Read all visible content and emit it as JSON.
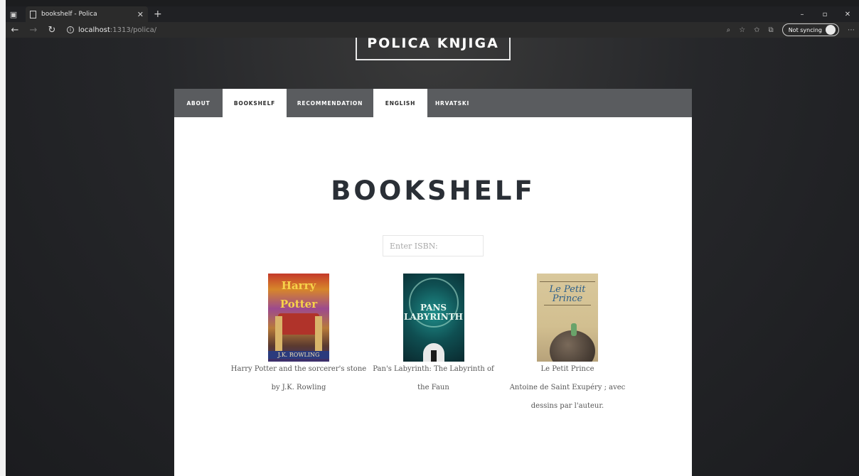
{
  "browser": {
    "tab_title": "bookshelf - Polica",
    "new_tab": "+",
    "url_host": "localhost",
    "url_path": ":1313/polica/",
    "sync_label": "Not syncing",
    "window_controls": [
      "–",
      "▫",
      "✕"
    ]
  },
  "site": {
    "logo": "POLICA KNJIGA",
    "nav": [
      {
        "label": "ABOUT",
        "active": false
      },
      {
        "label": "BOOKSHELF",
        "active": true
      },
      {
        "label": "RECOMMENDATION",
        "active": false
      },
      {
        "label": "ENGLISH",
        "active": true
      },
      {
        "label": "HRVATSKI",
        "active": false
      }
    ]
  },
  "main": {
    "heading": "BOOKSHELF",
    "isbn_placeholder": "Enter ISBN:"
  },
  "books": [
    {
      "title": "Harry Potter and the sorcerer's stone",
      "author": "by J.K. Rowling",
      "cover_text": "Harry Potter",
      "cover_author": "J.K. ROWLING"
    },
    {
      "title": "Pan's Labyrinth: The Labyrinth of",
      "author": "the Faun",
      "cover_text": "PANS LABYRINTH"
    },
    {
      "title": "Le Petit Prince",
      "author_line1": "Antoine de Saint Exupéry ; avec",
      "author_line2": "dessins par l'auteur.",
      "cover_text": "Le Petit Prince"
    }
  ]
}
